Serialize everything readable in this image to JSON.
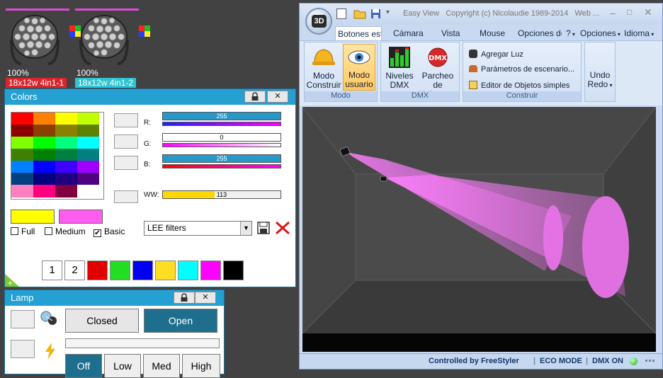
{
  "fixtures": [
    {
      "percent": "100%",
      "name": "18x12w 4in1-1",
      "name_color": "#d8262c"
    },
    {
      "percent": "100%",
      "name": "18x12w 4in1-2",
      "name_color": "#2fc4d0"
    }
  ],
  "colors_panel": {
    "title": "Colors",
    "lock_icon": "lock-icon",
    "close_label": "✕",
    "palette": [
      [
        "#ff0000",
        "#ff8000",
        "#ffff00",
        "#c0ff00"
      ],
      [
        "#8b0000",
        "#8b4000",
        "#8b8000",
        "#608000"
      ],
      [
        "#80ff00",
        "#00ff00",
        "#00ff80",
        "#00ffff"
      ],
      [
        "#408000",
        "#008000",
        "#008040",
        "#008080"
      ],
      [
        "#0080ff",
        "#0000ff",
        "#4000ff",
        "#a000ff"
      ],
      [
        "#004080",
        "#000080",
        "#200080",
        "#500080"
      ],
      [
        "#ff80c0",
        "#ff0080",
        "#800040",
        "#ffffff"
      ]
    ],
    "channels": [
      {
        "label": "R:",
        "value": "255",
        "top_color": "#2898c8",
        "bottom": "linear-gradient(90deg,#2020ff,#ff00ff)"
      },
      {
        "label": "G:",
        "value": "0",
        "top_color": "#ffffff",
        "bottom": "linear-gradient(90deg,#ff00ff,#ffffff)"
      },
      {
        "label": "B:",
        "value": "255",
        "top_color": "#2898c8",
        "bottom": "linear-gradient(90deg,#ff0000,#ff00ff)"
      },
      {
        "label": "WW:",
        "value": "113",
        "top_color": "#ffd700",
        "bottom": ""
      }
    ],
    "preview_left": "#ffff00",
    "preview_right": "#ff5cf0",
    "options": [
      {
        "label": "Full",
        "checked": false
      },
      {
        "label": "Medium",
        "checked": false
      },
      {
        "label": "Basic",
        "checked": true
      }
    ],
    "filter_select": "LEE filters",
    "save_icon": "floppy-disk-icon",
    "delete_icon": "red-x-icon",
    "presets": [
      "1",
      "2"
    ],
    "preset_colors": [
      "#e00000",
      "#22dd22",
      "#0000ee",
      "#ffdd22",
      "#00ffff",
      "#ff00ff",
      "#000000"
    ]
  },
  "lamp_panel": {
    "title": "Lamp",
    "close_label": "✕",
    "closed_label": "Closed",
    "open_label": "Open",
    "levels": [
      "Off",
      "Low",
      "Med",
      "High"
    ]
  },
  "window": {
    "title": "Easy View   Copyright (c) Nicolaudie 1989-2014   Web ...",
    "logo": "3D",
    "tabs": [
      "Botones est",
      "Cámara",
      "Vista",
      "Mouse",
      "Opciones de",
      "?",
      "Opciones",
      "Idioma"
    ],
    "ribbon": {
      "modo_construir": "Modo Construir",
      "modo_usuario": "Modo usuario",
      "modo_group": "Modo",
      "niveles": "Niveles DMX",
      "parcheo": "Parcheo de Universos",
      "dmx_group": "DMX",
      "agregar_luz": "Agregar Luz",
      "parametros": "Parámetros de escenario...",
      "editor": "Editor de Objetos simples",
      "construir_group": "Construir",
      "undo": "Undo",
      "redo": "Redo",
      "dmx_badge": "DMX"
    },
    "status": {
      "controlled": "Controlled by FreeStyler",
      "eco": "ECO MODE",
      "dmx": "DMX ON"
    }
  }
}
